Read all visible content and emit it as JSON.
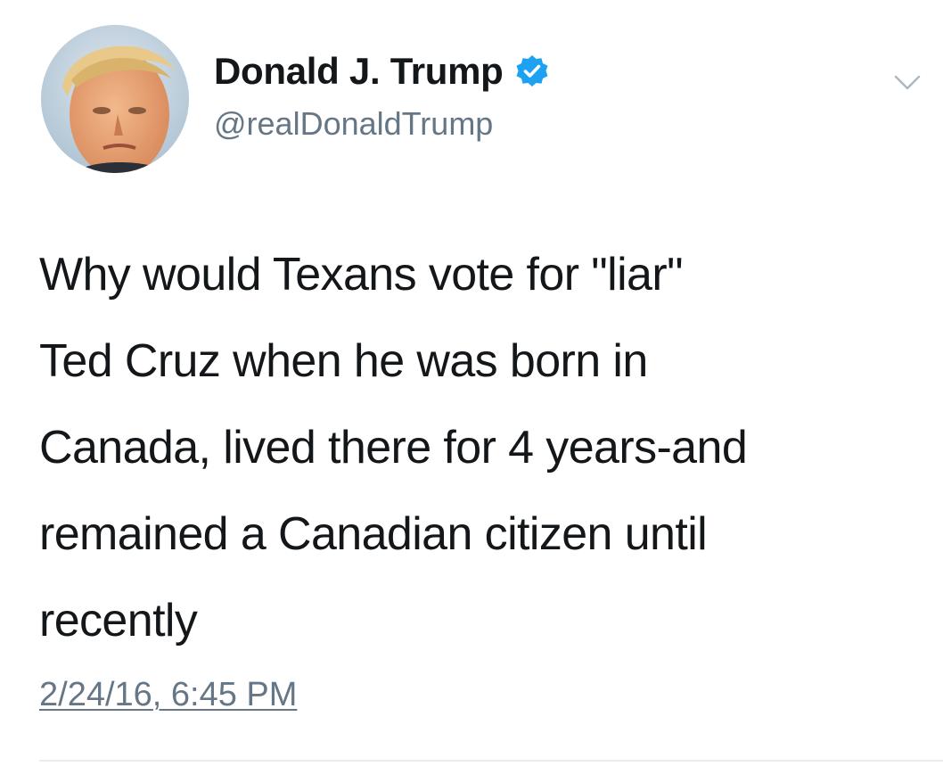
{
  "author": {
    "display_name": "Donald J. Trump",
    "handle": "@realDonaldTrump",
    "verified": true
  },
  "tweet": {
    "text": "Why would Texans vote for \"liar\"\nTed Cruz when he was born in\nCanada, lived there for 4 years-and\nremained a Canadian citizen until\nrecently",
    "timestamp": "2/24/16, 6:45 PM"
  },
  "icons": {
    "verified": "verified-badge-icon",
    "menu": "chevron-down-icon"
  },
  "colors": {
    "verified_blue": "#1da1f2",
    "secondary_text": "#657786",
    "primary_text": "#14171a"
  }
}
